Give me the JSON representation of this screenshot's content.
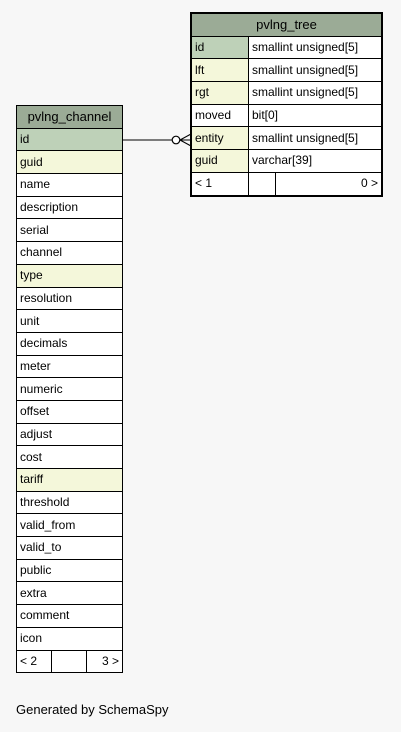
{
  "tables": {
    "channel": {
      "name": "pvlng_channel",
      "columns": [
        {
          "name": "id",
          "kind": "pk"
        },
        {
          "name": "guid",
          "kind": "fk"
        },
        {
          "name": "name",
          "kind": ""
        },
        {
          "name": "description",
          "kind": ""
        },
        {
          "name": "serial",
          "kind": ""
        },
        {
          "name": "channel",
          "kind": ""
        },
        {
          "name": "type",
          "kind": "fk"
        },
        {
          "name": "resolution",
          "kind": ""
        },
        {
          "name": "unit",
          "kind": ""
        },
        {
          "name": "decimals",
          "kind": ""
        },
        {
          "name": "meter",
          "kind": ""
        },
        {
          "name": "numeric",
          "kind": ""
        },
        {
          "name": "offset",
          "kind": ""
        },
        {
          "name": "adjust",
          "kind": ""
        },
        {
          "name": "cost",
          "kind": ""
        },
        {
          "name": "tariff",
          "kind": "fk"
        },
        {
          "name": "threshold",
          "kind": ""
        },
        {
          "name": "valid_from",
          "kind": ""
        },
        {
          "name": "valid_to",
          "kind": ""
        },
        {
          "name": "public",
          "kind": ""
        },
        {
          "name": "extra",
          "kind": ""
        },
        {
          "name": "comment",
          "kind": ""
        },
        {
          "name": "icon",
          "kind": ""
        }
      ],
      "footer": {
        "parents": "< 2",
        "children": "3 >"
      }
    },
    "tree": {
      "name": "pvlng_tree",
      "columns": [
        {
          "name": "id",
          "type": "smallint unsigned[5]",
          "kind": "pk"
        },
        {
          "name": "lft",
          "type": "smallint unsigned[5]",
          "kind": "fk"
        },
        {
          "name": "rgt",
          "type": "smallint unsigned[5]",
          "kind": "fk"
        },
        {
          "name": "moved",
          "type": "bit[0]",
          "kind": ""
        },
        {
          "name": "entity",
          "type": "smallint unsigned[5]",
          "kind": "fk"
        },
        {
          "name": "guid",
          "type": "varchar[39]",
          "kind": "fk"
        }
      ],
      "footer": {
        "parents": "< 1",
        "children": "0 >"
      }
    }
  },
  "colors": {
    "header": "#9bab96",
    "primary_key": "#bed1b8",
    "foreign_key": "#f4f7da",
    "background": "#f7f7f7"
  },
  "footer_text": "Generated by SchemaSpy"
}
